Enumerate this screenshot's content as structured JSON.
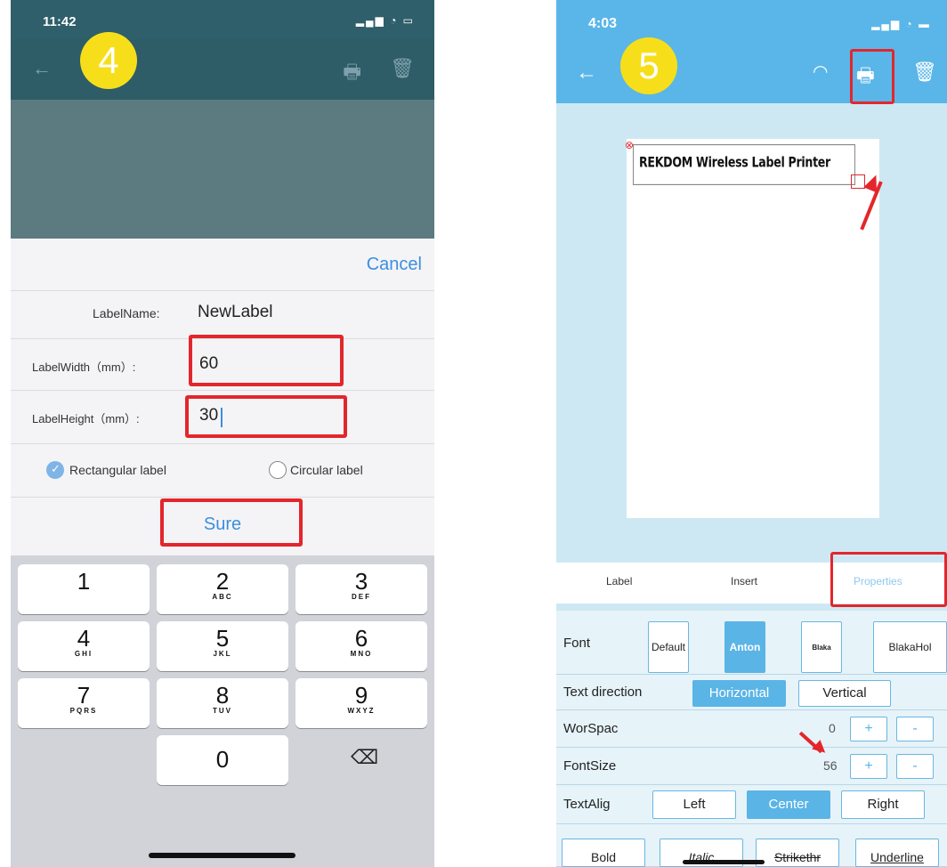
{
  "left": {
    "status": {
      "time": "11:42",
      "signal": "‥…"
    },
    "badge": "4",
    "cancel_label": "Cancel",
    "label_name": {
      "label": "LabelName:",
      "value": "NewLabel"
    },
    "label_width": {
      "label": "LabelWidth（mm）:",
      "value": "60"
    },
    "label_height": {
      "label": "LabelHeight（mm）:",
      "value": "30"
    },
    "shape_options": [
      {
        "label": "Rectangular label",
        "checked": true
      },
      {
        "label": "Circular label",
        "checked": false
      }
    ],
    "sure_label": "Sure",
    "keypad": [
      {
        "digit": "1",
        "letters": ""
      },
      {
        "digit": "2",
        "letters": "ABC"
      },
      {
        "digit": "3",
        "letters": "DEF"
      },
      {
        "digit": "4",
        "letters": "GHI"
      },
      {
        "digit": "5",
        "letters": "JKL"
      },
      {
        "digit": "6",
        "letters": "MNO"
      },
      {
        "digit": "7",
        "letters": "PQRS"
      },
      {
        "digit": "8",
        "letters": "TUV"
      },
      {
        "digit": "9",
        "letters": "WXYZ"
      },
      {
        "digit": "0",
        "letters": ""
      }
    ],
    "delete_symbol": "⌫"
  },
  "right": {
    "status": {
      "time": "4:03"
    },
    "badge": "5",
    "canvas_text": "REKDOM Wireless Label Printer",
    "tabs": [
      {
        "label": "Label",
        "active": false
      },
      {
        "label": "Insert",
        "active": false
      },
      {
        "label": "Properties",
        "active": true
      }
    ],
    "font": {
      "label": "Font",
      "options": [
        {
          "label": "Default",
          "selected": false
        },
        {
          "label": "Anton",
          "selected": true
        },
        {
          "label": "Blaka",
          "selected": false
        },
        {
          "label": "BlakaHol",
          "selected": false
        }
      ]
    },
    "text_direction": {
      "label": "Text direction",
      "options": [
        {
          "label": "Horizontal",
          "selected": true
        },
        {
          "label": "Vertical",
          "selected": false
        }
      ]
    },
    "word_spacing": {
      "label": "WorSpac",
      "value": "0",
      "plus": "+",
      "minus": "-"
    },
    "font_size": {
      "label": "FontSize",
      "value": "56",
      "plus": "+",
      "minus": "-"
    },
    "text_align": {
      "label": "TextAlig",
      "options": [
        {
          "label": "Left",
          "selected": false
        },
        {
          "label": "Center",
          "selected": true
        },
        {
          "label": "Right",
          "selected": false
        }
      ]
    },
    "styles": [
      "Bold",
      "Italic",
      "Strikethr",
      "Underline"
    ]
  },
  "colors": {
    "accent_red": "#e3262c",
    "badge_yellow": "#f6df1a",
    "left_header": "#2e5d68",
    "right_header": "#5ab6e8",
    "link_blue": "#3c8ee0"
  }
}
